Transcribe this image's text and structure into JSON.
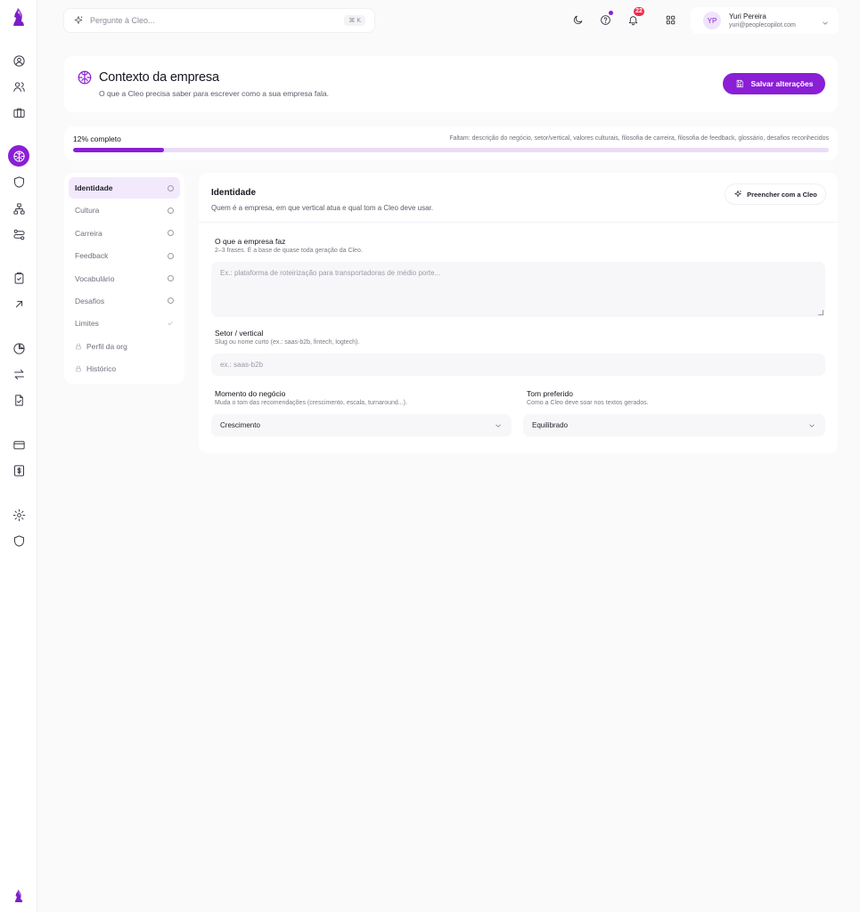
{
  "search": {
    "placeholder": "Pergunte à Cleo...",
    "shortcut": "⌘ K"
  },
  "topbar": {
    "notifications_count": "22"
  },
  "user": {
    "initials": "YP",
    "name": "Yuri Pereira",
    "email": "yuri@peoplecopilot.com"
  },
  "header": {
    "title": "Contexto da empresa",
    "subtitle": "O que a Cleo precisa saber para escrever como a sua empresa fala.",
    "save_label": "Salvar alterações"
  },
  "progress": {
    "label": "12% completo",
    "fraction": 0.12,
    "missing": "Faltam: descrição do negócio, setor/vertical, valores culturais, filosofia de carreira, filosofia de feedback, glossário, desafios reconhecidos"
  },
  "nav": {
    "items": [
      {
        "label": "Identidade",
        "status": "pending"
      },
      {
        "label": "Cultura",
        "status": "pending"
      },
      {
        "label": "Carreira",
        "status": "pending"
      },
      {
        "label": "Feedback",
        "status": "pending"
      },
      {
        "label": "Vocabulário",
        "status": "pending"
      },
      {
        "label": "Desafios",
        "status": "pending"
      },
      {
        "label": "Limites",
        "status": "done"
      },
      {
        "label": "Perfil da org",
        "status": "locked"
      },
      {
        "label": "Histórico",
        "status": "locked"
      }
    ]
  },
  "form": {
    "title": "Identidade",
    "subtitle": "Quem é a empresa, em que vertical atua e qual tom a Cleo deve usar.",
    "fill_label": "Preencher com a Cleo",
    "business": {
      "label": "O que a empresa faz",
      "help": "2–3 frases. É a base de quase toda geração da Cleo.",
      "placeholder": "Ex.: plataforma de roteirização para transportadoras de médio porte..."
    },
    "sector": {
      "label": "Setor / vertical",
      "help": "Slug ou nome curto (ex.: saas-b2b, fintech, logtech).",
      "placeholder": "ex.: saas-b2b"
    },
    "moment": {
      "label": "Momento do negócio",
      "help": "Muda o tom das recomendações (crescimento, escala, turnaround...).",
      "value": "Crescimento"
    },
    "tone": {
      "label": "Tom preferido",
      "help": "Como a Cleo deve soar nos textos gerados.",
      "value": "Equilibrado"
    }
  },
  "colors": {
    "accent": "#8a1fd6",
    "accent_soft": "#f3e9fc",
    "badge": "#ef2b4d"
  }
}
